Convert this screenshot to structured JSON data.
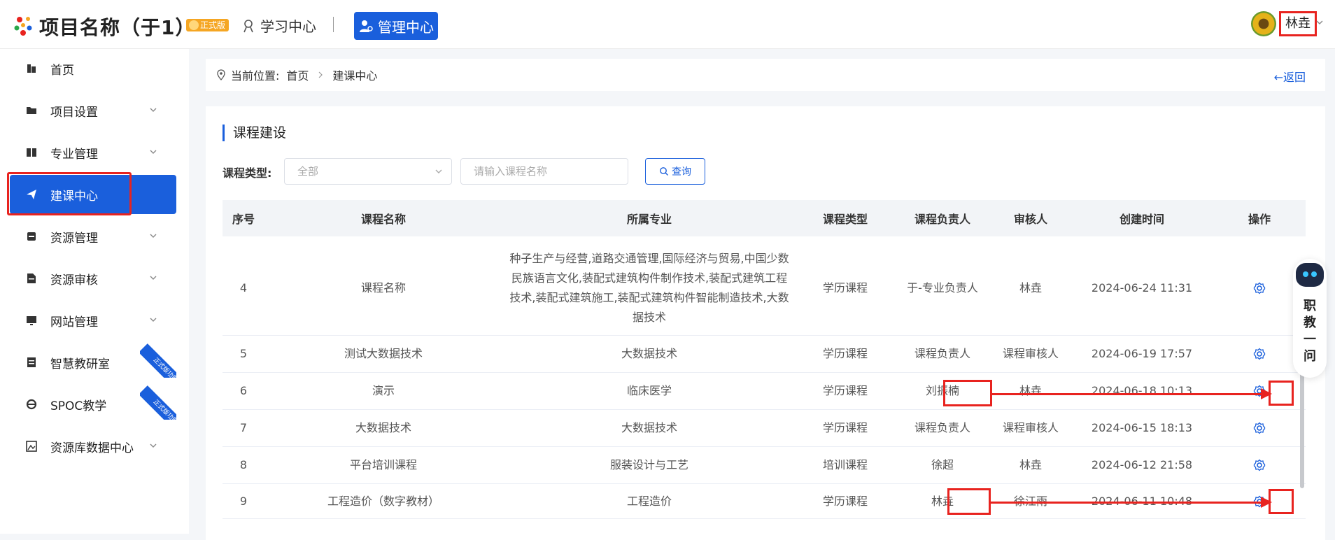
{
  "header": {
    "app_title": "项目名称（于1）",
    "badge": "正式版",
    "nav_study": "学习中心",
    "nav_manage": "管理中心",
    "user_name": "林垚"
  },
  "sidebar": {
    "items": [
      {
        "label": "首页"
      },
      {
        "label": "项目设置"
      },
      {
        "label": "专业管理"
      },
      {
        "label": "建课中心"
      },
      {
        "label": "资源管理"
      },
      {
        "label": "资源审核"
      },
      {
        "label": "网站管理"
      },
      {
        "label": "智慧教研室",
        "ribbon": "正式版功能"
      },
      {
        "label": "SPOC教学",
        "ribbon": "正式版功能"
      },
      {
        "label": "资源库数据中心"
      }
    ]
  },
  "breadcrumb": {
    "prefix": "当前位置:",
    "home": "首页",
    "current": "建课中心",
    "back": "返回"
  },
  "main": {
    "section_title": "课程建设",
    "filter_label": "课程类型:",
    "type_select": "全部",
    "search_placeholder": "请输入课程名称",
    "query_button": "查询",
    "columns": [
      "序号",
      "课程名称",
      "所属专业",
      "课程类型",
      "课程负责人",
      "审核人",
      "创建时间",
      "操作"
    ],
    "rows": [
      {
        "no": "4",
        "name": "课程名称",
        "major": "种子生产与经营,道路交通管理,国际经济与贸易,中国少数民族语言文化,装配式建筑构件制作技术,装配式建筑工程技术,装配式建筑施工,装配式建筑构件智能制造技术,大数据技术",
        "type": "学历课程",
        "owner": "于-专业负责人",
        "reviewer": "林垚",
        "created": "2024-06-24 11:31"
      },
      {
        "no": "5",
        "name": "测试大数据技术",
        "major": "大数据技术",
        "type": "学历课程",
        "owner": "课程负责人",
        "reviewer": "课程审核人",
        "created": "2024-06-19 17:57"
      },
      {
        "no": "6",
        "name": "演示",
        "major": "临床医学",
        "type": "学历课程",
        "owner": "刘振楠",
        "reviewer": "林垚",
        "created": "2024-06-18 10:13"
      },
      {
        "no": "7",
        "name": "大数据技术",
        "major": "大数据技术",
        "type": "学历课程",
        "owner": "课程负责人",
        "reviewer": "课程审核人",
        "created": "2024-06-15 18:13"
      },
      {
        "no": "8",
        "name": "平台培训课程",
        "major": "服装设计与工艺",
        "type": "培训课程",
        "owner": "徐超",
        "reviewer": "林垚",
        "created": "2024-06-12 21:58"
      },
      {
        "no": "9",
        "name": "工程造价（数字教材）",
        "major": "工程造价",
        "type": "学历课程",
        "owner": "林垚",
        "reviewer": "徐江雨",
        "created": "2024-06-11 10:48"
      }
    ]
  },
  "assistant": {
    "label": "职教一问"
  },
  "colors": {
    "primary": "#1a5fdc",
    "highlight": "#e8231f",
    "badge": "#f5a623"
  }
}
